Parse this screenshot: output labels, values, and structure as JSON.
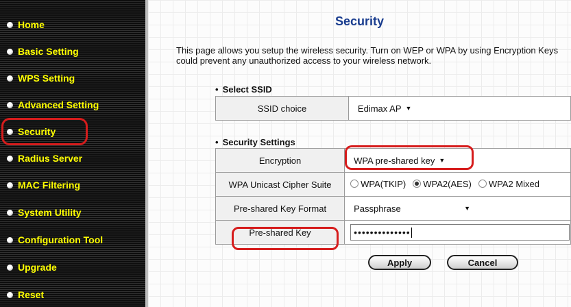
{
  "sidebar": {
    "items": [
      {
        "label": "Home"
      },
      {
        "label": "Basic Setting"
      },
      {
        "label": "WPS Setting"
      },
      {
        "label": "Advanced Setting"
      },
      {
        "label": "Security"
      },
      {
        "label": "Radius Server"
      },
      {
        "label": "MAC Filtering"
      },
      {
        "label": "System Utility"
      },
      {
        "label": "Configuration Tool"
      },
      {
        "label": "Upgrade"
      },
      {
        "label": "Reset"
      }
    ],
    "active": "Security"
  },
  "main": {
    "title": "Security",
    "description": "This page allows you setup the wireless security. Turn on WEP or WPA by using Encryption Keys could prevent any unauthorized access to your wireless network.",
    "select_ssid": {
      "heading": "Select SSID",
      "ssid_choice_label": "SSID choice",
      "ssid_choice_value": "Edimax AP"
    },
    "security_settings": {
      "heading": "Security Settings",
      "encryption_label": "Encryption",
      "encryption_value": "WPA pre-shared key",
      "cipher_label": "WPA Unicast Cipher Suite",
      "cipher_options": [
        "WPA(TKIP)",
        "WPA2(AES)",
        "WPA2 Mixed"
      ],
      "cipher_selected": "WPA2(AES)",
      "key_format_label": "Pre-shared Key Format",
      "key_format_value": "Passphrase",
      "key_label": "Pre-shared Key",
      "key_value": "••••••••••••••"
    },
    "apply_label": "Apply",
    "cancel_label": "Cancel"
  },
  "colors": {
    "sidebar_text": "#ffff00",
    "title": "#1a3d8f",
    "highlight": "#d61c1c"
  }
}
